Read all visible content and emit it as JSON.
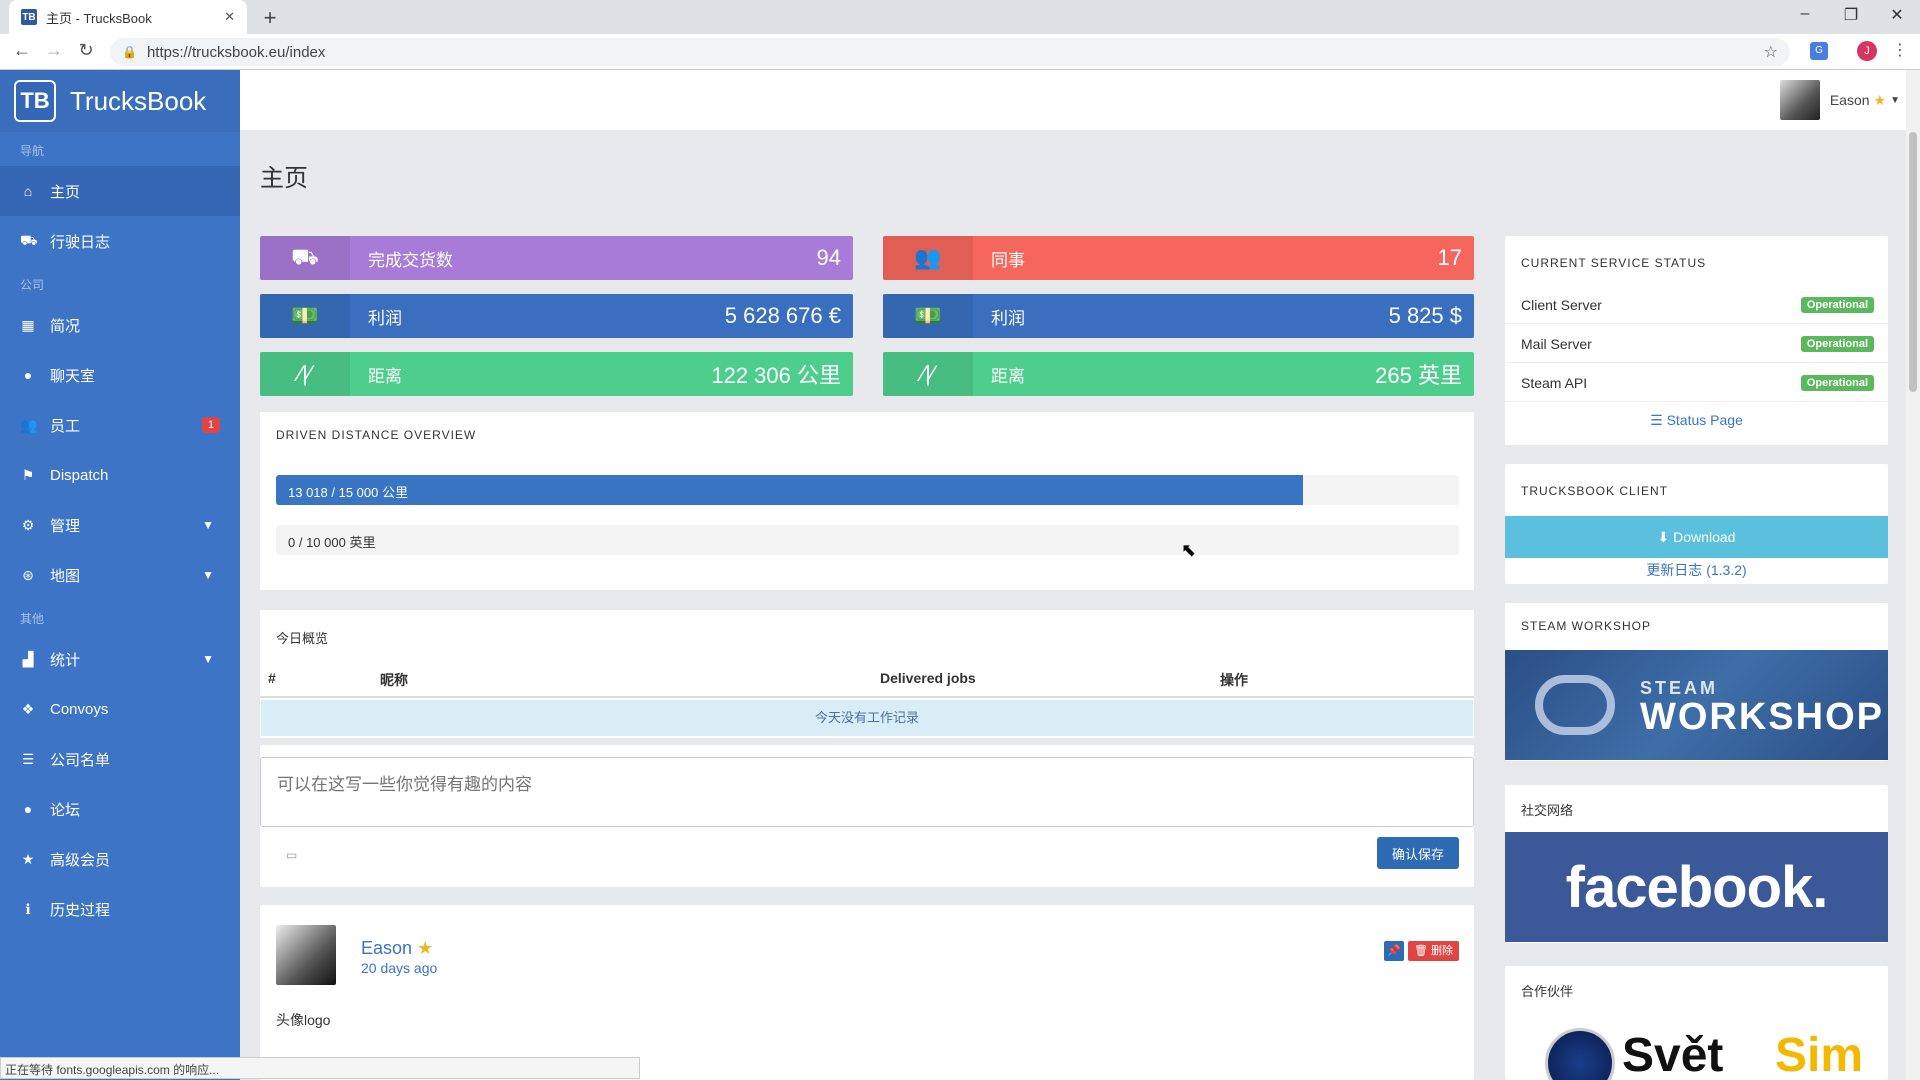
{
  "browser": {
    "tab_title": "主页 - TrucksBook",
    "tab_favicon": "TB",
    "url": "https://trucksbook.eu/index",
    "status_text": "正在等待 fonts.googleapis.com 的响应...",
    "profile_initial": "J"
  },
  "brand": {
    "logo": "TB",
    "name": "TrucksBook"
  },
  "sidebar": {
    "sections": [
      "导航",
      "公司",
      "其他"
    ],
    "items": [
      {
        "label": "主页",
        "icon": "home-icon"
      },
      {
        "label": "行驶日志",
        "icon": "truck-icon"
      },
      {
        "label": "简况",
        "icon": "building-icon"
      },
      {
        "label": "聊天室",
        "icon": "chat-icon"
      },
      {
        "label": "员工",
        "icon": "users-icon",
        "badge": "1"
      },
      {
        "label": "Dispatch",
        "icon": "signpost-icon"
      },
      {
        "label": "管理",
        "icon": "cogs-icon"
      },
      {
        "label": "地图",
        "icon": "map-icon"
      },
      {
        "label": "统计",
        "icon": "chart-icon"
      },
      {
        "label": "Convoys",
        "icon": "cubes-icon"
      },
      {
        "label": "公司名单",
        "icon": "list-icon"
      },
      {
        "label": "论坛",
        "icon": "comments-icon"
      },
      {
        "label": "高级会员",
        "icon": "star-icon"
      },
      {
        "label": "历史过程",
        "icon": "info-icon"
      }
    ]
  },
  "header": {
    "user_name": "Eason"
  },
  "page": {
    "title": "主页"
  },
  "stats": [
    {
      "label": "完成交货数",
      "value": "94",
      "icon": "truck-loading-icon"
    },
    {
      "label": "同事",
      "value": "17",
      "icon": "users-icon"
    },
    {
      "label": "利润",
      "value": "5 628 676 €",
      "icon": "money-icon"
    },
    {
      "label": "利润",
      "value": "5 825 $",
      "icon": "money-icon"
    },
    {
      "label": "距离",
      "value": "122 306 公里",
      "icon": "road-icon"
    },
    {
      "label": "距离",
      "value": "265 英里",
      "icon": "road-icon"
    }
  ],
  "distance": {
    "title": "DRIVEN DISTANCE OVERVIEW",
    "bar1": {
      "text": "13 018 / 15 000 公里",
      "fraction": 0.868
    },
    "bar2": {
      "text": "0 / 10 000 英里",
      "fraction": 0
    }
  },
  "today": {
    "title": "今日概览",
    "columns": [
      "#",
      "昵称",
      "Delivered jobs",
      "操作"
    ],
    "empty": "今天没有工作记录"
  },
  "composer": {
    "placeholder": "可以在这写一些你觉得有趣的内容",
    "save": "确认保存"
  },
  "post": {
    "author": "Eason",
    "time": "20 days ago",
    "body": "头像logo",
    "delete": "删除"
  },
  "service": {
    "title": "CURRENT SERVICE STATUS",
    "rows": [
      {
        "name": "Client Server",
        "status": "Operational"
      },
      {
        "name": "Mail Server",
        "status": "Operational"
      },
      {
        "name": "Steam API",
        "status": "Operational"
      }
    ],
    "link": "Status Page"
  },
  "client": {
    "title": "TRUCKSBOOK CLIENT",
    "download": "Download",
    "changelog": "更新日志 (1.3.2)"
  },
  "workshop": {
    "title": "STEAM WORKSHOP",
    "banner_small": "STEAM",
    "banner_big": "WORKSHOP"
  },
  "social": {
    "title": "社交网络",
    "banner": "facebook."
  },
  "partners": {
    "title": "合作伙伴",
    "brand1": "Svět",
    "brand2": "Sim"
  }
}
